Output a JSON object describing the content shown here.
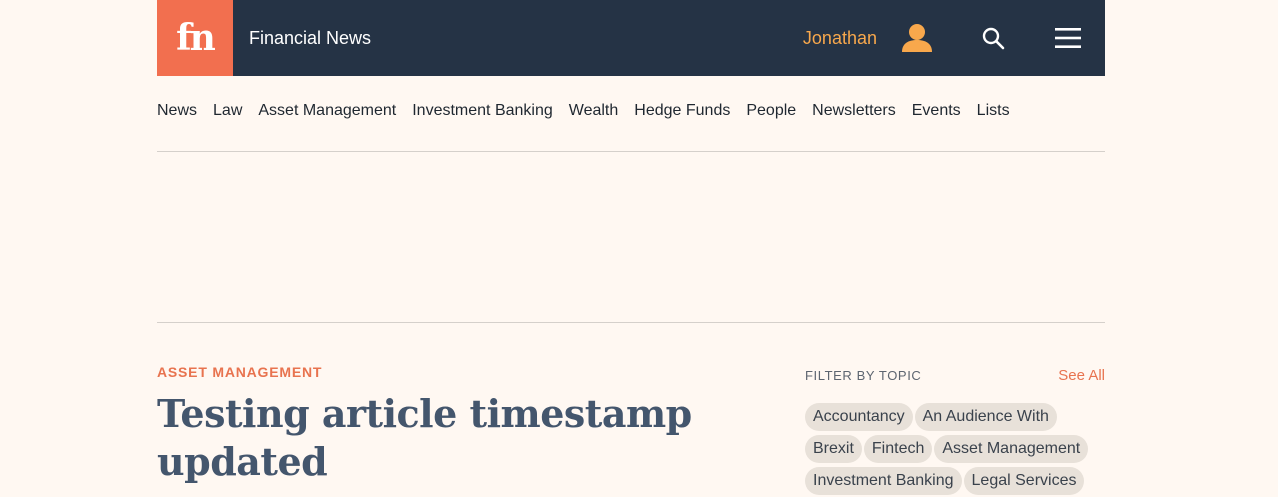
{
  "header": {
    "logo_text": "fn",
    "brand": "Financial News",
    "user_name": "Jonathan",
    "user_icon": "user-icon",
    "search_icon": "search-icon",
    "menu_icon": "hamburger-menu-icon",
    "colors": {
      "bar": "#253345",
      "logo_bg": "#f26f4f",
      "user": "#f8a84c"
    }
  },
  "nav": {
    "items": [
      "News",
      "Law",
      "Asset Management",
      "Investment Banking",
      "Wealth",
      "Hedge Funds",
      "People",
      "Newsletters",
      "Events",
      "Lists"
    ]
  },
  "article": {
    "kicker": "ASSET MANAGEMENT",
    "headline": "Testing article timestamp updated"
  },
  "sidebar": {
    "filter_label": "FILTER BY TOPIC",
    "see_all": "See All",
    "tags": [
      "Accountancy",
      "An Audience With",
      "Brexit",
      "Fintech",
      "Asset Management",
      "Investment Banking",
      "Legal Services"
    ]
  }
}
